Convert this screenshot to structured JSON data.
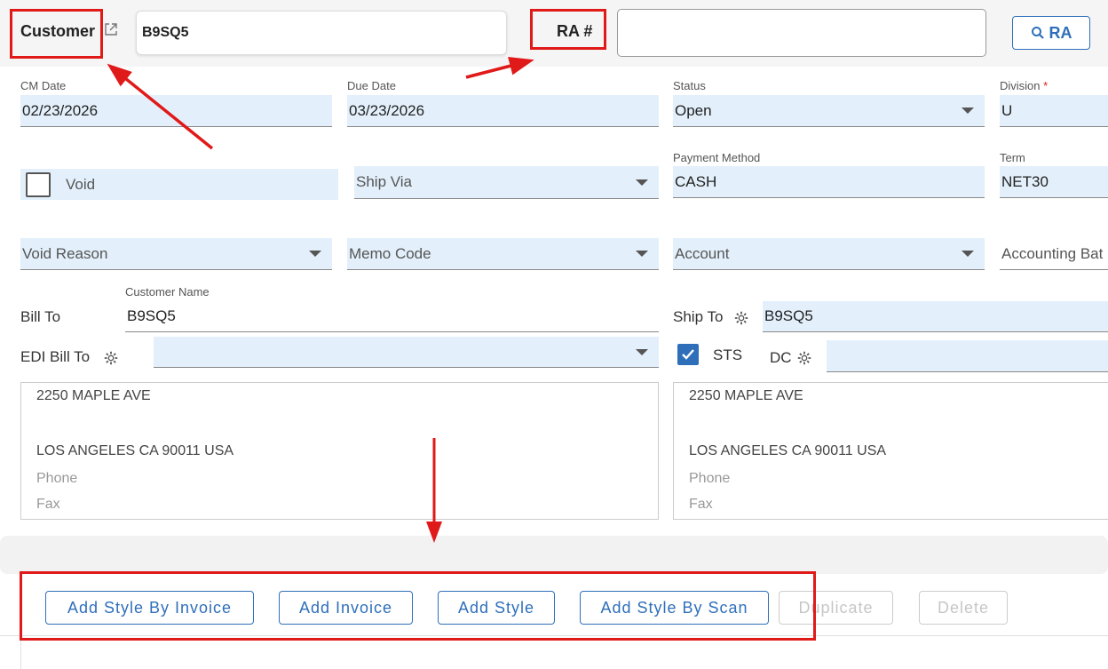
{
  "header": {
    "customer_label": "Customer",
    "customer_value": "B9SQ5",
    "ra_label": "RA #",
    "ra_value": "",
    "ra_search_button": "RA"
  },
  "row1": {
    "cm_date_label": "CM Date",
    "cm_date_value": "02/23/2026",
    "due_date_label": "Due Date",
    "due_date_value": "03/23/2026",
    "status_label": "Status",
    "status_value": "Open",
    "division_label": "Division",
    "division_required": "*",
    "division_value": "U"
  },
  "row2": {
    "void_label": "Void",
    "void_checked": false,
    "ship_via_placeholder": "Ship Via",
    "payment_method_label": "Payment Method",
    "payment_method_value": "CASH",
    "term_label": "Term",
    "term_value": "NET30"
  },
  "row3": {
    "void_reason_placeholder": "Void Reason",
    "memo_code_placeholder": "Memo Code",
    "account_placeholder": "Account",
    "accounting_batch_placeholder": "Accounting Bat"
  },
  "bill_to": {
    "label": "Bill To",
    "customer_name_label": "Customer Name",
    "customer_name_value": "B9SQ5",
    "edi_bill_to_label": "EDI Bill To",
    "edi_bill_to_value": "",
    "address_line1": "2250 MAPLE AVE",
    "address_line2": "LOS ANGELES CA 90011 USA",
    "phone_label": "Phone",
    "fax_label": "Fax"
  },
  "ship_to": {
    "label": "Ship To",
    "value": "B9SQ5",
    "sts_label": "STS",
    "sts_checked": true,
    "dc_label": "DC",
    "dc_value": "",
    "address_line1": "2250 MAPLE AVE",
    "address_line2": "LOS ANGELES CA 90011 USA",
    "phone_label": "Phone",
    "fax_label": "Fax"
  },
  "actions": {
    "add_style_by_invoice": "Add Style By Invoice",
    "add_invoice": "Add Invoice",
    "add_style": "Add Style",
    "add_style_by_scan": "Add Style By Scan",
    "duplicate": "Duplicate",
    "delete": "Delete"
  },
  "colors": {
    "accent": "#2f6fba",
    "field_bg": "#e3f0fb",
    "annotation_red": "#e01919"
  },
  "icons": [
    "external-link-icon",
    "search-icon",
    "gear-icon",
    "chevron-down-icon",
    "checkmark-icon"
  ]
}
